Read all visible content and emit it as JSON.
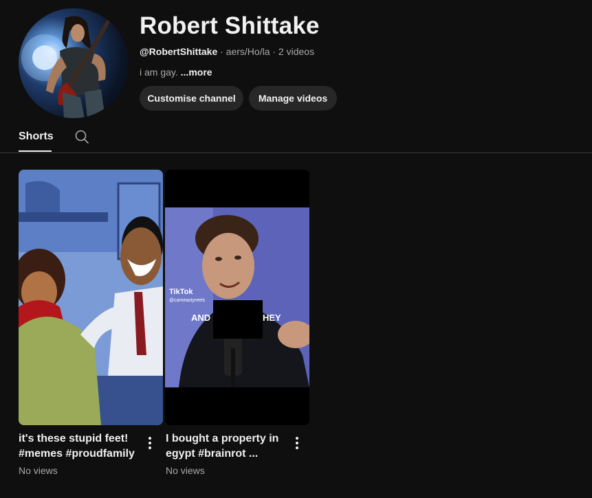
{
  "channel": {
    "name": "Robert Shittake",
    "handle": "@RobertShittake",
    "meta_rest": " · aers/Ho/la · 2 videos",
    "description": "i am gay. ",
    "more_label": "...more"
  },
  "buttons": {
    "customise": "Customise channel",
    "manage": "Manage videos"
  },
  "tabs": {
    "shorts": "Shorts"
  },
  "shorts": [
    {
      "title": "it's these stupid feet! #memes #proudfamily",
      "views": "No views"
    },
    {
      "title": "I bought a property in egypt #brainrot ...",
      "views": "No views"
    }
  ],
  "thumb2_overlay": {
    "brand": "TikTok",
    "account": "@cameastyreels",
    "caption_left": "AND",
    "caption_right": "HEY"
  },
  "colors": {
    "background": "#0f0f0f",
    "button": "#272727",
    "text_primary": "#f1f1f1",
    "text_secondary": "#aaaaaa"
  }
}
